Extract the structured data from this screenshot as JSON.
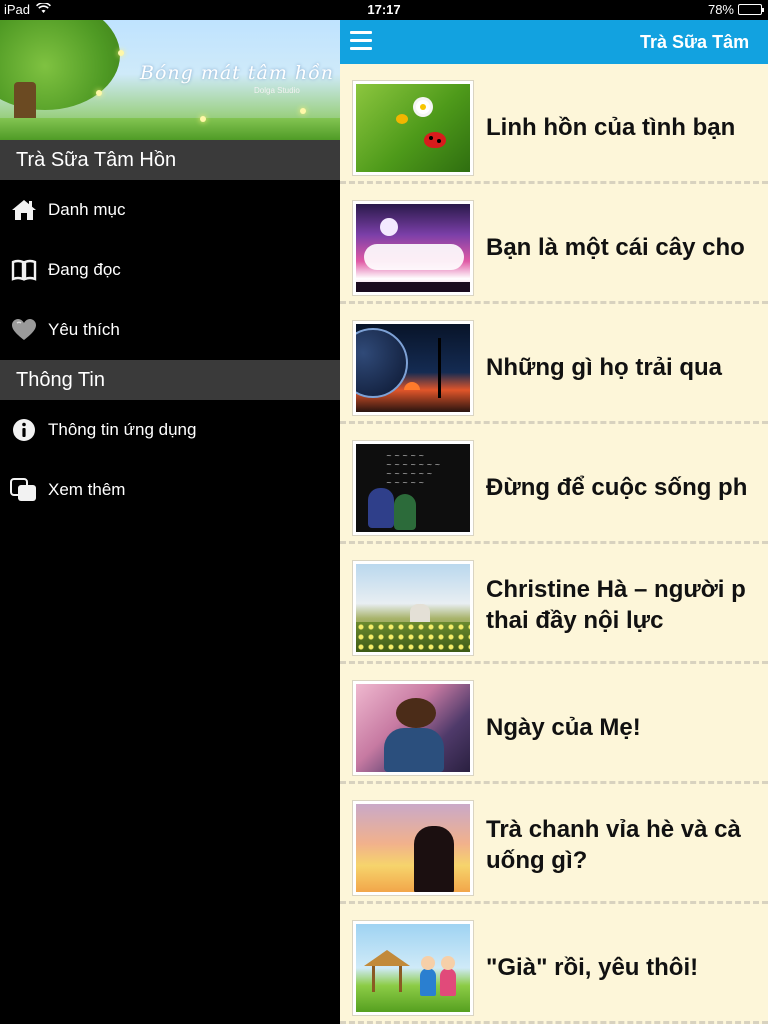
{
  "status_bar": {
    "device": "iPad",
    "time": "17:17",
    "battery": "78%",
    "battery_level": 0.78
  },
  "sidebar": {
    "banner_title": "Bóng mát tâm hồn",
    "banner_subtitle": "Dolga Studio",
    "sections": [
      {
        "header": "Trà Sữa Tâm Hồn",
        "items": [
          {
            "label": "Danh mục",
            "icon": "home-icon"
          },
          {
            "label": "Đang đọc",
            "icon": "book-icon"
          },
          {
            "label": "Yêu thích",
            "icon": "heart-icon"
          }
        ]
      },
      {
        "header": "Thông Tin",
        "items": [
          {
            "label": "Thông tin ứng dụng",
            "icon": "info-icon"
          },
          {
            "label": "Xem thêm",
            "icon": "more-apps-icon"
          }
        ]
      }
    ]
  },
  "content": {
    "nav_title": "Trà Sữa Tâm",
    "menu_icon": "hamburger-menu-icon",
    "articles": [
      {
        "title_lines": [
          "Linh hồn của tình bạn"
        ]
      },
      {
        "title_lines": [
          "Bạn là một cái cây cho"
        ]
      },
      {
        "title_lines": [
          "Những gì họ trải qua"
        ]
      },
      {
        "title_lines": [
          "Đừng để cuộc sống ph"
        ]
      },
      {
        "title_lines": [
          "Christine Hà – người p",
          "thai đầy nội lực"
        ]
      },
      {
        "title_lines": [
          "Ngày của Mẹ!"
        ]
      },
      {
        "title_lines": [
          "Trà chanh vỉa hè và cà",
          "uống gì?"
        ]
      },
      {
        "title_lines": [
          "\"Già\" rồi, yêu thôi!"
        ]
      }
    ]
  },
  "colors": {
    "nav_bar": "#12a2e0",
    "content_bg": "#fdf6d9",
    "sidebar_bg": "#000000",
    "section_header_bg": "#3a3a3a"
  }
}
